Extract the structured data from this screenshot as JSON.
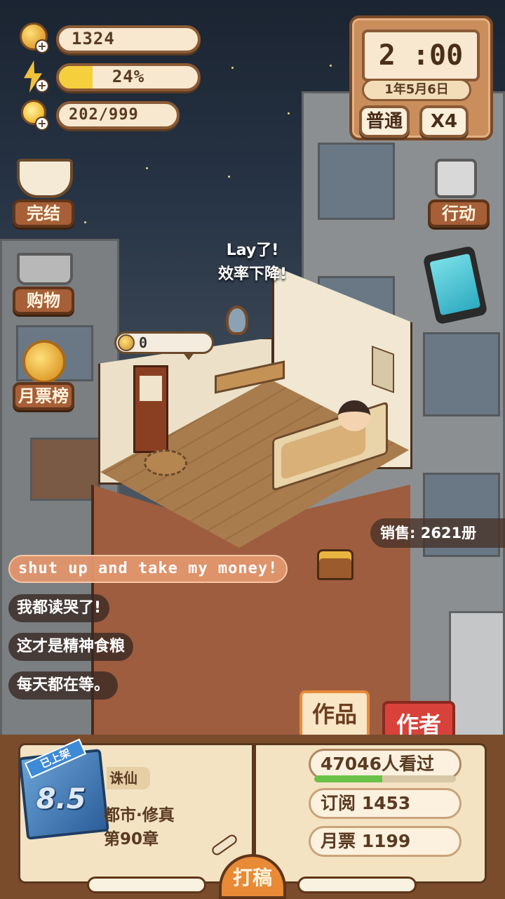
{
  "resources": {
    "coins": "1324",
    "energy_text": "24%",
    "energy_fraction": 0.24,
    "inspiration": "202/999"
  },
  "clock": {
    "time": "2 :00",
    "date": "1年5月6日",
    "mode": "普通",
    "speed": "X4"
  },
  "left_menu": {
    "finish": "完结",
    "shop": "购物",
    "monthly_rank": "月票榜"
  },
  "right_menu": {
    "action": "行动"
  },
  "room": {
    "status_line1": "Lay了!",
    "status_line2": "效率下降!",
    "coin_bubble": "0"
  },
  "sales": "销售: 2621册",
  "comments": [
    "shut up and take my money!",
    "我都读哭了!",
    "这才是精神食粮",
    "每天都在等。"
  ],
  "tabs": {
    "works": "作品",
    "author": "作者"
  },
  "book": {
    "badge": "已上架",
    "score": "8.5",
    "title": "诛仙",
    "genre": "都市·修真",
    "chapter": "第90章",
    "views": "47046人看过",
    "views_progress": 0.48,
    "subscriptions": "订阅 1453",
    "monthly_votes": "月票 1199",
    "write_button": "打稿"
  },
  "colors": {
    "accent_orange": "#e88a36",
    "author_tab_red": "#d8423a",
    "views_green": "#6bc148",
    "energy_yellow": "#f5cf3c"
  }
}
